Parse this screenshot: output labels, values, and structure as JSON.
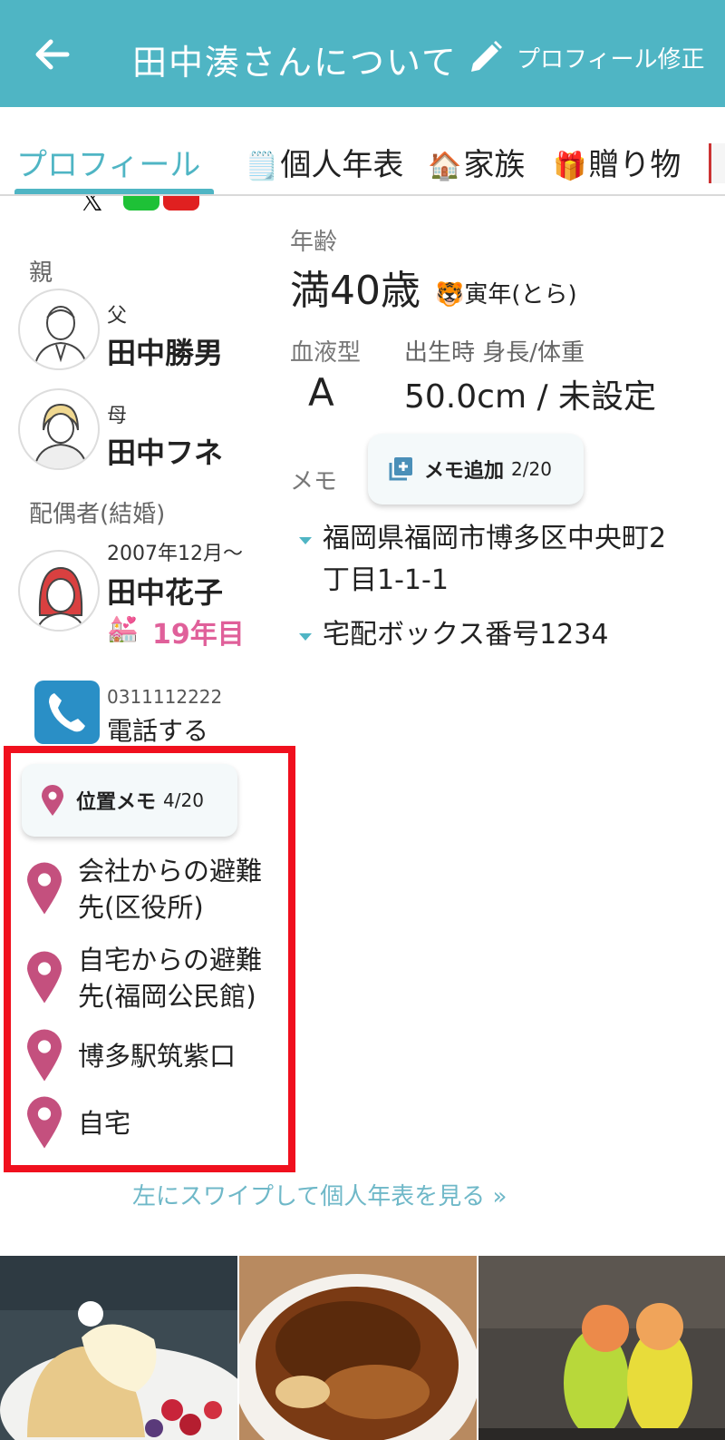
{
  "header": {
    "title": "田中湊さんについて",
    "edit_label": "プロフィール修正"
  },
  "tabs": [
    {
      "label": "プロフィール",
      "icon": "",
      "active": true
    },
    {
      "label": "個人年表",
      "icon": "🗒️"
    },
    {
      "label": "家族",
      "icon": "🏠"
    },
    {
      "label": "贈り物",
      "icon": "🎁"
    }
  ],
  "left": {
    "parents_label": "親",
    "father": {
      "relation": "父",
      "name": "田中勝男"
    },
    "mother": {
      "relation": "母",
      "name": "田中フネ"
    },
    "spouse_label": "配偶者(結婚)",
    "spouse": {
      "since": "2007年12月～",
      "name": "田中花子",
      "years": "19年目",
      "years_icon": "💒"
    },
    "phone": {
      "number": "0311112222",
      "action": "電話する"
    },
    "location_memo": {
      "button_label": "位置メモ",
      "count": "4/20",
      "items": [
        {
          "line1": "会社からの避難",
          "line2": "先(区役所)"
        },
        {
          "line1": "自宅からの避難",
          "line2": "先(福岡公民館)"
        },
        {
          "line1": "博多駅筑紫口",
          "line2": ""
        },
        {
          "line1": "自宅",
          "line2": ""
        }
      ]
    },
    "swipe_hint": "左にスワイプして個人年表を見る »"
  },
  "right": {
    "age_label": "年齢",
    "age": "満40歳",
    "zodiac": "🐯寅年(とら)",
    "blood_label": "血液型",
    "blood": "A",
    "birth_label": "出生時 身長/体重",
    "birth_value": "50.0cm / 未設定",
    "memo_label": "メモ",
    "memo_add_label": "メモ追加",
    "memo_count": "2/20",
    "memos": [
      {
        "line1": "福岡県福岡市博多区中央町2",
        "line2": "丁目1-1-1"
      },
      {
        "line1": "宅配ボックス番号1234",
        "line2": ""
      }
    ]
  },
  "colors": {
    "accent": "#4fb5c4",
    "pin": "#c4507e",
    "highlight": "#f0101e",
    "years": "#e0609a"
  }
}
